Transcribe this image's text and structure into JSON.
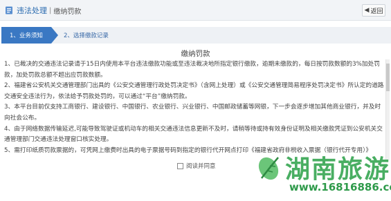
{
  "header": {
    "title": "违法处理",
    "separator": "|",
    "current": "缴纳罚款",
    "back_label": "返回"
  },
  "steps": [
    {
      "label": "1、业务须知",
      "active": true
    },
    {
      "label": "2、选择缴款记录",
      "active": false
    }
  ],
  "panel": {
    "title": "缴纳罚款",
    "paragraphs": [
      "1、已裁决的交通违法记录请于15日内使用本平台违法缴款功能或至违法裁决地所指定银行缴款，逾期未缴款的，每日按罚款数额的3%加处罚款，加处罚款总额不超出应罚款数额。",
      "2、福建省公安机关交通管理部门出具的《公安交通管理行政处罚决定书》（含网上处理）或《公安交通管理简易程序处罚决定书》所认定的道路交通安全违法行为，依法给予罚款处罚的，可以通过“平台”缴纳罚款。",
      "3、本平台目前仅支持工商银行、建设银行、中国银行、农业银行、兴业银行、中国邮政储蓄等网银，下一步会逐步增加其他商业银行，并及时向社会公布。",
      "4、由于网络数据传输延迟,可能导致驾驶证或机动车的相关交通违法信息更新不及时，请稍等待或持有效身份证明及相关缴款凭证到公安机关交通管理部门交通违法处理窗口核实处理。",
      "5、需打印纸质罚款票据的，可凭网上缴费时出具的电子票据号码到指定的银行代开网点打印《福建省政府非税收入票据（银行代开专用）》"
    ]
  },
  "agree": {
    "label": "阅读并同意",
    "checked": false
  },
  "watermark": {
    "text": "湖南旅游",
    "url": "www.16816886.com"
  },
  "colors": {
    "accent": "#3a78c3",
    "watermark": "#3aa855"
  }
}
